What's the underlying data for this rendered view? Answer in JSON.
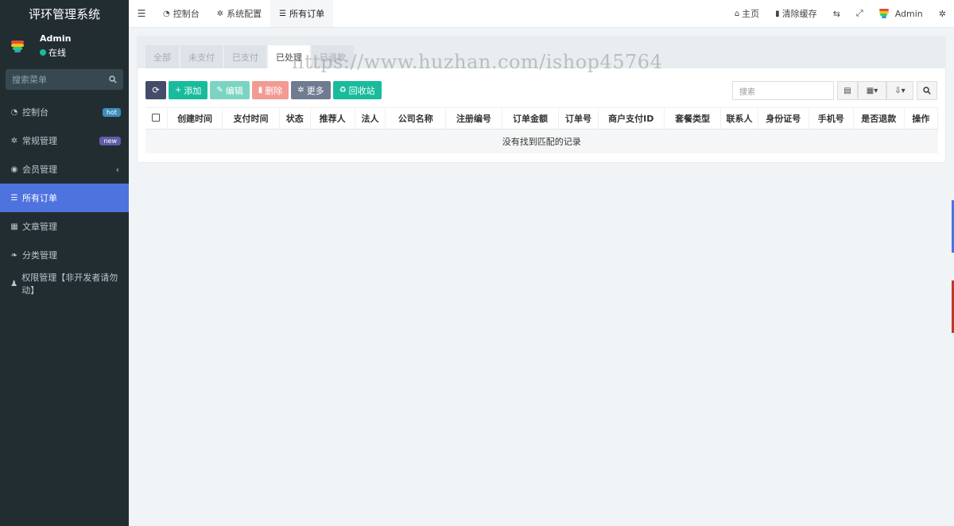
{
  "sidebar": {
    "brand": "评环管理系统",
    "user": {
      "name": "Admin",
      "status": "在线"
    },
    "search_placeholder": "搜索菜单",
    "items": [
      {
        "label": "控制台",
        "icon": "dashboard-icon",
        "badge": "hot"
      },
      {
        "label": "常规管理",
        "icon": "cogs-icon",
        "badge": "new"
      },
      {
        "label": "会员管理",
        "icon": "user-circle-icon",
        "chevron": "‹"
      },
      {
        "label": "所有订单",
        "icon": "list-icon",
        "active": true
      },
      {
        "label": "文章管理",
        "icon": "calendar-icon"
      },
      {
        "label": "分类管理",
        "icon": "leaf-icon"
      },
      {
        "label": "权限管理【非开发者请勿动】",
        "icon": "group-icon"
      }
    ]
  },
  "topbar": {
    "tabs": [
      {
        "label": "控制台",
        "icon": "dashboard-icon"
      },
      {
        "label": "系统配置",
        "icon": "cog-icon"
      },
      {
        "label": "所有订单",
        "icon": "list-icon",
        "active": true
      }
    ],
    "home": "主页",
    "clear_cache": "清除缓存",
    "admin": "Admin"
  },
  "panel": {
    "tabs": [
      "全部",
      "未支付",
      "已支付",
      "已处理",
      "已退款"
    ],
    "active_tab": "已处理",
    "buttons": {
      "add": "添加",
      "edit": "编辑",
      "delete": "删除",
      "more": "更多",
      "recycle": "回收站"
    },
    "search_placeholder": "搜索",
    "columns": [
      "创建时间",
      "支付时间",
      "状态",
      "推荐人",
      "法人",
      "公司名称",
      "注册编号",
      "订单金额",
      "订单号",
      "商户支付ID",
      "套餐类型",
      "联系人",
      "身份证号",
      "手机号",
      "是否退款",
      "操作"
    ],
    "empty_text": "没有找到匹配的记录"
  },
  "watermark": "https://www.huzhan.com/ishop45764",
  "colors": {
    "sidebar_bg": "#222d32",
    "active": "#4e73df",
    "success": "#18bc9c",
    "danger": "#f29b93"
  }
}
